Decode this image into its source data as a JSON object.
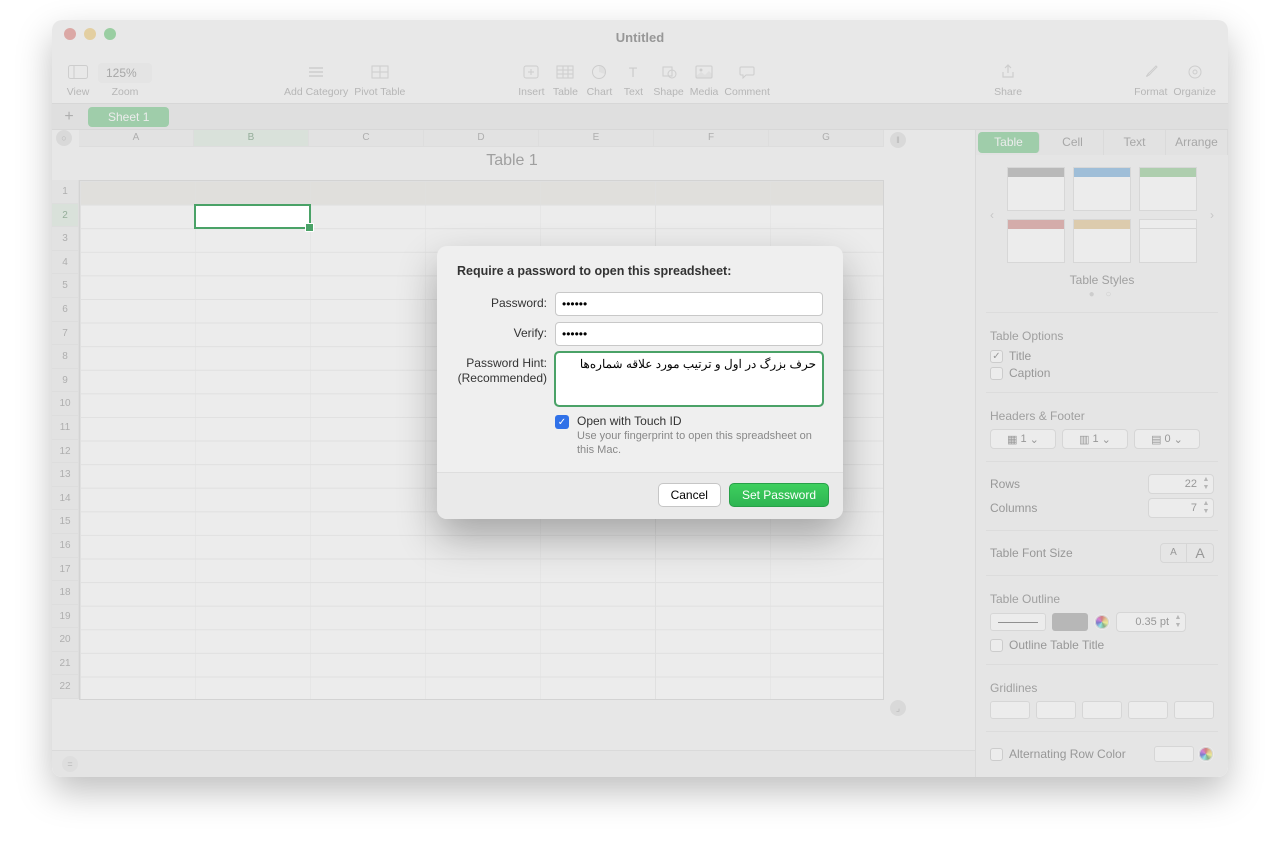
{
  "window": {
    "title": "Untitled"
  },
  "toolbar": {
    "view": "View",
    "zoom_value": "125%",
    "zoom_label": "Zoom",
    "add_category": "Add Category",
    "pivot_table": "Pivot Table",
    "insert": "Insert",
    "table": "Table",
    "chart": "Chart",
    "text": "Text",
    "shape": "Shape",
    "media": "Media",
    "comment": "Comment",
    "share": "Share",
    "format": "Format",
    "organize": "Organize"
  },
  "sheets": {
    "add": "+",
    "tab1": "Sheet 1"
  },
  "table": {
    "title": "Table 1",
    "columns": [
      "A",
      "B",
      "C",
      "D",
      "E",
      "F",
      "G"
    ],
    "rows": [
      "1",
      "2",
      "3",
      "4",
      "5",
      "6",
      "7",
      "8",
      "9",
      "10",
      "11",
      "12",
      "13",
      "14",
      "15",
      "16",
      "17",
      "18",
      "19",
      "20",
      "21",
      "22"
    ],
    "selected_col": "B",
    "selected_row": "2"
  },
  "inspector": {
    "tabs": {
      "table": "Table",
      "cell": "Cell",
      "text": "Text",
      "arrange": "Arrange"
    },
    "styles_label": "Table Styles",
    "options_label": "Table Options",
    "title_opt": "Title",
    "caption_opt": "Caption",
    "headers_label": "Headers & Footer",
    "header_rows": "1",
    "header_cols": "1",
    "footer_rows": "0",
    "rows_label": "Rows",
    "rows_value": "22",
    "cols_label": "Columns",
    "cols_value": "7",
    "font_size_label": "Table Font Size",
    "font_small": "A",
    "font_large": "A",
    "outline_label": "Table Outline",
    "outline_pt": "0.35 pt",
    "outline_title_opt": "Outline Table Title",
    "gridlines_label": "Gridlines",
    "alt_row_label": "Alternating Row Color"
  },
  "dialog": {
    "heading": "Require a password to open this spreadsheet:",
    "password_label": "Password:",
    "password_value": "••••••",
    "verify_label": "Verify:",
    "verify_value": "••••••",
    "hint_label": "Password Hint:",
    "hint_sub": "(Recommended)",
    "hint_value": "حرف بزرگ در اول و ترتیب مورد علاقه شماره‌ها",
    "touchid_label": "Open with Touch ID",
    "touchid_desc": "Use your fingerprint to open this spreadsheet on this Mac.",
    "cancel": "Cancel",
    "set": "Set Password"
  }
}
